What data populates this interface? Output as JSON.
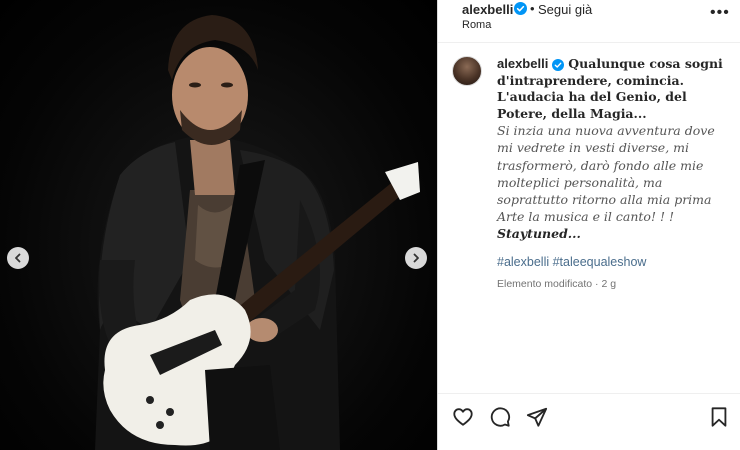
{
  "post": {
    "username": "alexbelli",
    "dot": "•",
    "follow_label": "Segui già",
    "location": "Roma",
    "more_label": "•••"
  },
  "caption": {
    "username": "alexbelli",
    "quote": "Qualunque cosa sogni d'intraprendere, comincia. L'audacia ha del Genio, del Potere, della Magia...",
    "body": "Si inzia una nuova avventura dove mi vedrete in vesti diverse, mi trasformerò, darò fondo alle mie molteplici personalità, ma soprattutto ritorno alla mia prima Arte la musica e il canto! ! !",
    "signoff": "Staytuned..."
  },
  "hashtags": [
    "#alexbelli",
    "#taleequaleshow"
  ],
  "edited_label": "Elemento modificato · 2 g",
  "icons": {
    "verified": "verified-badge-icon",
    "like": "heart-icon",
    "comment": "comment-bubble-icon",
    "share": "paper-plane-icon",
    "save": "bookmark-icon",
    "prev": "chevron-left-icon",
    "next": "chevron-right-icon"
  },
  "colors": {
    "verified": "#0095f6",
    "hashtag": "#4a6d8c",
    "text": "#262626",
    "muted": "#737373"
  }
}
